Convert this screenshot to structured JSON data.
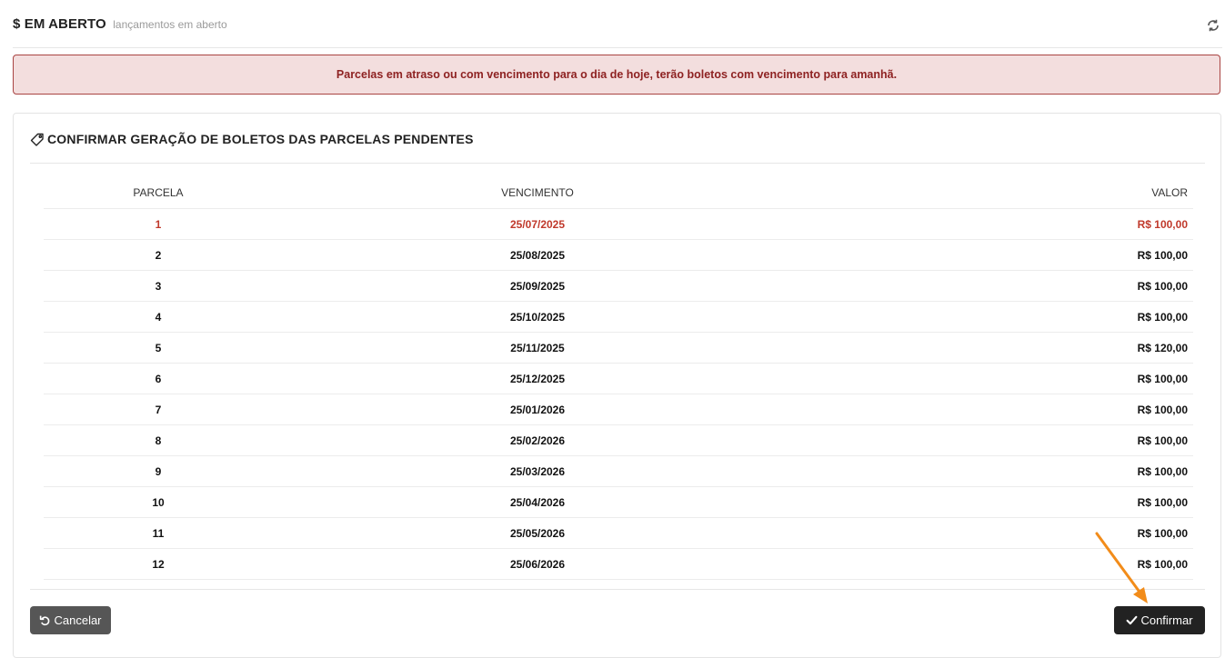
{
  "header": {
    "title": "$ EM ABERTO",
    "subtitle": "lançamentos em aberto",
    "refresh_icon": "refresh-icon"
  },
  "alert": {
    "message": "Parcelas em atraso ou com vencimento para o dia de hoje, terão boletos com vencimento para amanhã."
  },
  "panel": {
    "icon": "tag-icon",
    "title": "CONFIRMAR GERAÇÃO DE BOLETOS DAS PARCELAS PENDENTES",
    "columns": [
      "PARCELA",
      "VENCIMENTO",
      "VALOR"
    ],
    "rows": [
      {
        "parcela": "1",
        "vencimento": "25/07/2025",
        "valor": "R$ 100,00",
        "overdue": true
      },
      {
        "parcela": "2",
        "vencimento": "25/08/2025",
        "valor": "R$ 100,00",
        "overdue": false
      },
      {
        "parcela": "3",
        "vencimento": "25/09/2025",
        "valor": "R$ 100,00",
        "overdue": false
      },
      {
        "parcela": "4",
        "vencimento": "25/10/2025",
        "valor": "R$ 100,00",
        "overdue": false
      },
      {
        "parcela": "5",
        "vencimento": "25/11/2025",
        "valor": "R$ 120,00",
        "overdue": false
      },
      {
        "parcela": "6",
        "vencimento": "25/12/2025",
        "valor": "R$ 100,00",
        "overdue": false
      },
      {
        "parcela": "7",
        "vencimento": "25/01/2026",
        "valor": "R$ 100,00",
        "overdue": false
      },
      {
        "parcela": "8",
        "vencimento": "25/02/2026",
        "valor": "R$ 100,00",
        "overdue": false
      },
      {
        "parcela": "9",
        "vencimento": "25/03/2026",
        "valor": "R$ 100,00",
        "overdue": false
      },
      {
        "parcela": "10",
        "vencimento": "25/04/2026",
        "valor": "R$ 100,00",
        "overdue": false
      },
      {
        "parcela": "11",
        "vencimento": "25/05/2026",
        "valor": "R$ 100,00",
        "overdue": false
      },
      {
        "parcela": "12",
        "vencimento": "25/06/2026",
        "valor": "R$ 100,00",
        "overdue": false
      }
    ]
  },
  "actions": {
    "cancel_label": "Cancelar",
    "cancel_icon": "undo-icon",
    "confirm_label": "Confirmar",
    "confirm_icon": "check-icon"
  },
  "colors": {
    "alert_bg": "#f3dede",
    "alert_border": "#a94442",
    "alert_text": "#8e2222",
    "overdue_text": "#c0392b",
    "cancel_button": "#565656",
    "confirm_button": "#222222",
    "annotation_arrow": "#f28c1a"
  }
}
